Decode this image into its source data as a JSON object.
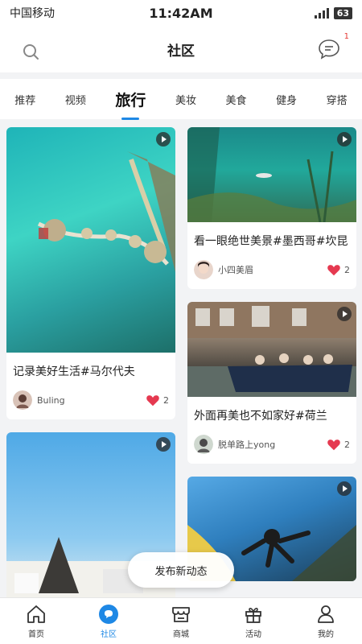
{
  "status_bar": {
    "carrier": "中国移动",
    "time": "11:42AM",
    "battery": "63"
  },
  "header": {
    "title": "社区",
    "message_badge": "1"
  },
  "tabs": [
    {
      "label": "推荐"
    },
    {
      "label": "视频"
    },
    {
      "label": "旅行",
      "active": true
    },
    {
      "label": "美妆"
    },
    {
      "label": "美食"
    },
    {
      "label": "健身"
    },
    {
      "label": "穿搭"
    }
  ],
  "feed": {
    "left": [
      {
        "title": "记录美好生活#马尔代夫",
        "author": "Buling",
        "likes": "2"
      },
      {
        "title": "",
        "author": "",
        "likes": ""
      }
    ],
    "right": [
      {
        "title": "看一眼绝世美景#墨西哥#坎昆",
        "author": "小四美眉",
        "likes": "2"
      },
      {
        "title": "外面再美也不如家好#荷兰",
        "author": "脱单路上yong",
        "likes": "2"
      },
      {
        "title": "",
        "author": "",
        "likes": ""
      }
    ]
  },
  "fab": {
    "label": "发布新动态"
  },
  "bottom_nav": [
    {
      "label": "首页",
      "icon": "home-icon"
    },
    {
      "label": "社区",
      "icon": "community-icon",
      "active": true
    },
    {
      "label": "商城",
      "icon": "store-icon"
    },
    {
      "label": "活动",
      "icon": "gift-icon"
    },
    {
      "label": "我的",
      "icon": "profile-icon"
    }
  ],
  "colors": {
    "accent": "#1e88e5",
    "heart": "#e53950"
  }
}
